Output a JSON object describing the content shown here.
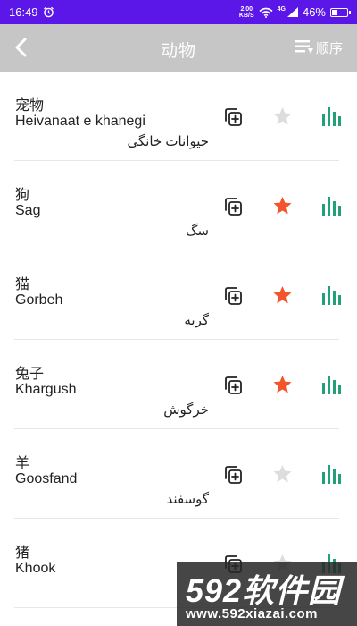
{
  "status_bar": {
    "time": "16:49",
    "net_speed_value": "2.00",
    "net_speed_unit": "KB/S",
    "network_type": "4G",
    "battery_percent": "46%",
    "battery_level": 0.46,
    "bg_color": "#5b16e8"
  },
  "header": {
    "title": "动物",
    "sort_label": "顺序",
    "back_icon": "chevron-left-icon",
    "sort_icon": "sort-lines-icon",
    "bg_color": "#c6c6c6"
  },
  "colors": {
    "star_active": "#f2552c",
    "star_inactive": "#dddddd",
    "bars": "#22a07a"
  },
  "items": [
    {
      "chinese": "宠物",
      "latin": "Heivanaat e khanegi",
      "persian": "حیوانات خانگی",
      "favorite": false
    },
    {
      "chinese": "狗",
      "latin": "Sag",
      "persian": "سگ",
      "favorite": true
    },
    {
      "chinese": "猫",
      "latin": "Gorbeh",
      "persian": "گربه",
      "favorite": true
    },
    {
      "chinese": "兔子",
      "latin": "Khargush",
      "persian": "خرگوش",
      "favorite": true
    },
    {
      "chinese": "羊",
      "latin": "Goosfand",
      "persian": "گوسفند",
      "favorite": false
    },
    {
      "chinese": "猪",
      "latin": "Khook",
      "persian": "",
      "favorite": false
    }
  ],
  "watermark": {
    "brand": "592软件园",
    "url": "www.592xiazai.com"
  }
}
